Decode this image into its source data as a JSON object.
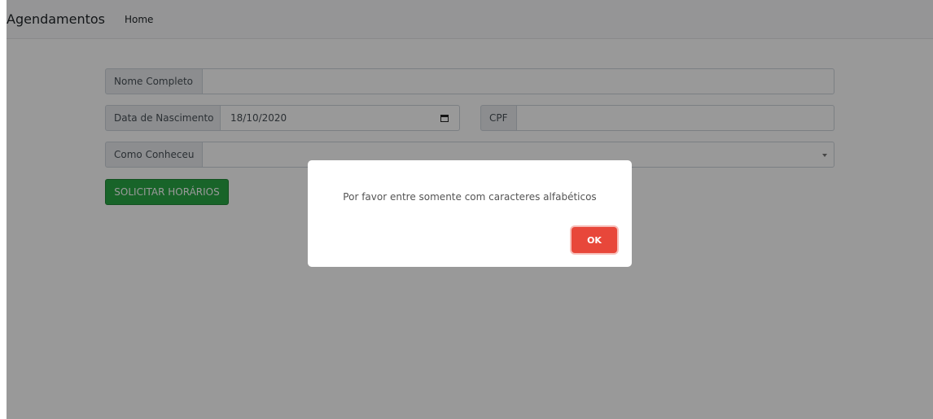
{
  "navbar": {
    "brand": "Agendamentos",
    "links": [
      "Home"
    ]
  },
  "form": {
    "name": {
      "label": "Nome Completo",
      "value": ""
    },
    "birthdate": {
      "label": "Data de Nascimento",
      "value": "18/10/2020"
    },
    "cpf": {
      "label": "CPF",
      "value": ""
    },
    "source": {
      "label": "Como Conheceu",
      "value": ""
    },
    "submit_label": "SOLICITAR HORÁRIOS"
  },
  "modal": {
    "message": "Por favor entre somente com caracteres alfabéticos",
    "ok_label": "OK"
  },
  "icons": {
    "date_picker": "calendar-icon",
    "select": "chevron-down-icon"
  },
  "colors": {
    "success": "#28a745",
    "confirm": "#e8473a",
    "overlay": "rgba(0,0,0,0.4)"
  }
}
